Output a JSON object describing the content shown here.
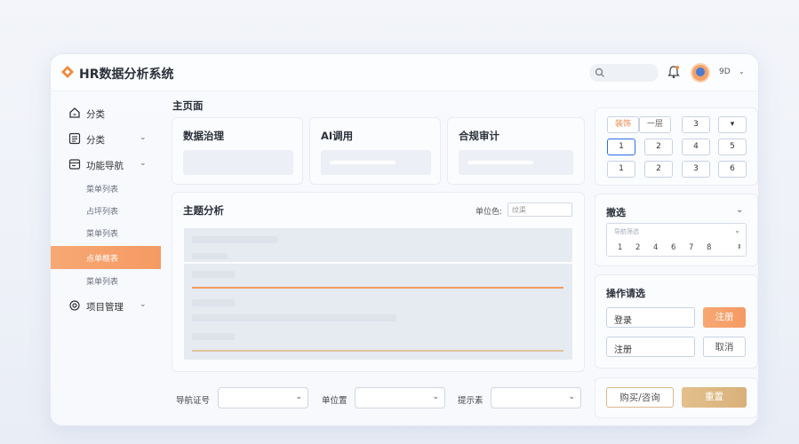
{
  "app": {
    "title": "HR数据分析系统"
  },
  "header": {
    "user_name": "9D"
  },
  "sidebar": {
    "items": [
      {
        "label": "分类"
      },
      {
        "label": "分类"
      },
      {
        "label": "功能导航"
      }
    ],
    "sub_items": [
      "菜单列表",
      "占坪列表",
      "菜单列表",
      "点单框表",
      "菜单列表"
    ],
    "project": {
      "label": "项目管理"
    }
  },
  "main": {
    "title": "主页面",
    "cards": [
      {
        "title": "数据治理"
      },
      {
        "title": "AI调用"
      },
      {
        "title": "合规审计"
      }
    ],
    "analysis": {
      "title": "主题分析",
      "unit_color_label": "单位色:",
      "unit_color_value": "纹渠"
    },
    "bottom": {
      "label1": "导航证号",
      "label2": "单位置",
      "label3": "提示素"
    }
  },
  "right": {
    "chips_row1": [
      "装饰",
      "一层",
      "3"
    ],
    "chips_row2": [
      "1",
      "2",
      "4",
      "5"
    ],
    "chips_row3": [
      "1",
      "2",
      "3",
      "6"
    ],
    "filter": {
      "title": "撤选",
      "placeholder": "导航筛选",
      "numbers": [
        "1",
        "2",
        "4",
        "6",
        "7",
        "8"
      ]
    },
    "operations": {
      "title": "操作请选",
      "login_value": "登录",
      "register_button": "注册",
      "register_value": "注册",
      "cancel_button": "取消"
    },
    "buy_button": "购买/咨询",
    "reset_button": "重置"
  }
}
